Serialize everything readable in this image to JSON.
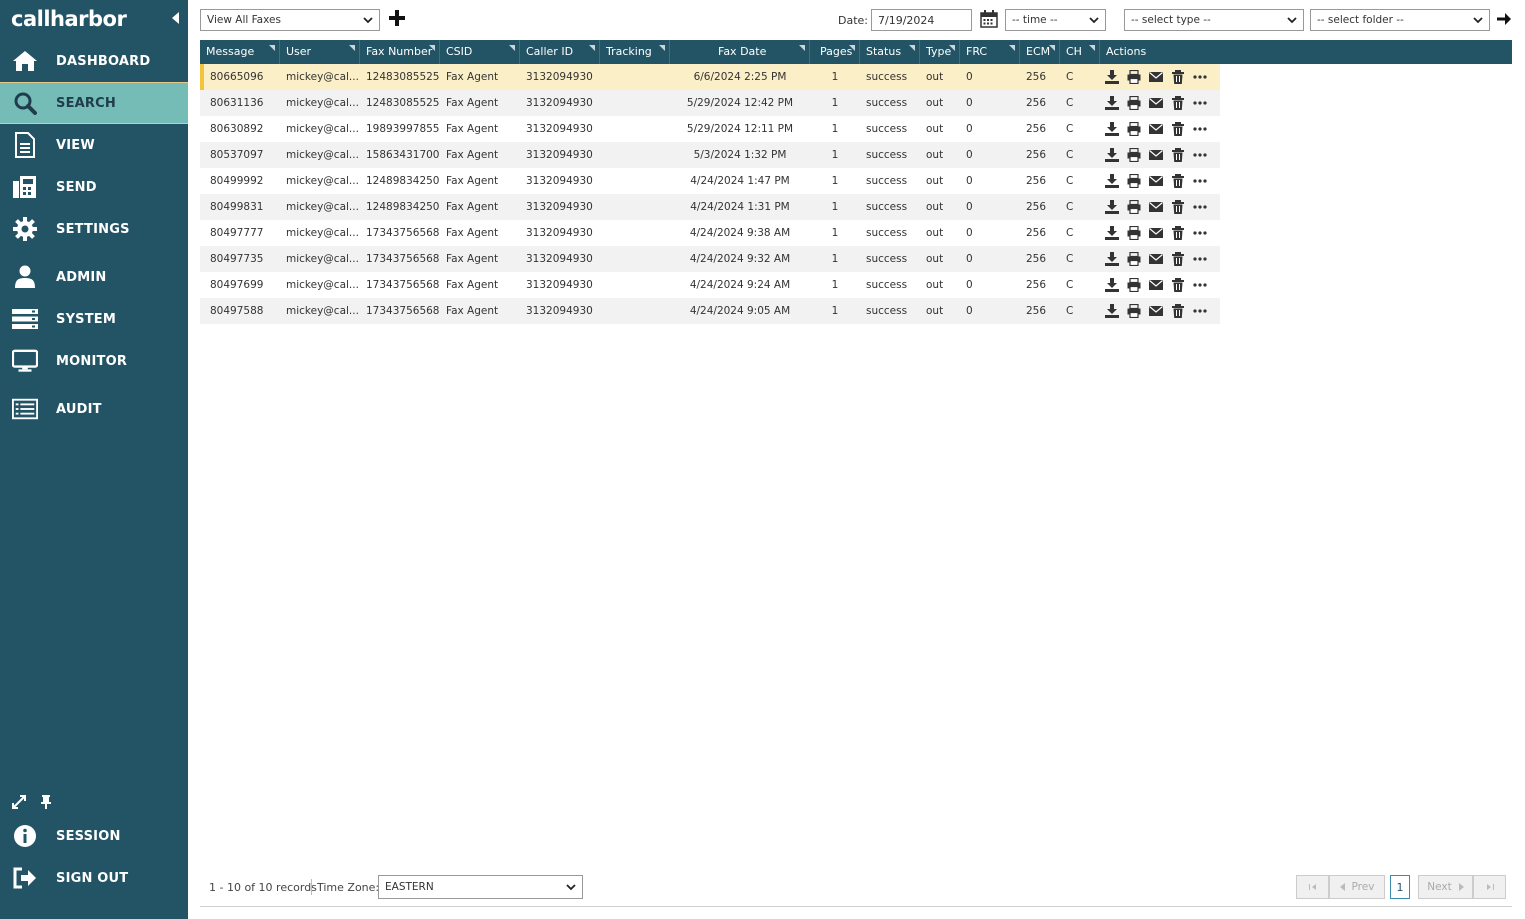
{
  "app": {
    "logo": "callharbor"
  },
  "sidebar": {
    "items": [
      {
        "label": "DASHBOARD",
        "icon": "home-icon"
      },
      {
        "label": "SEARCH",
        "icon": "search-icon",
        "active": true
      },
      {
        "label": "VIEW",
        "icon": "document-icon"
      },
      {
        "label": "SEND",
        "icon": "fax-icon"
      },
      {
        "label": "SETTINGS",
        "icon": "gear-icon"
      },
      {
        "label": "ADMIN",
        "icon": "user-icon"
      },
      {
        "label": "SYSTEM",
        "icon": "server-icon"
      },
      {
        "label": "MONITOR",
        "icon": "monitor-icon"
      },
      {
        "label": "AUDIT",
        "icon": "list-icon"
      }
    ],
    "bottom": [
      {
        "label": "SESSION",
        "icon": "info-icon"
      },
      {
        "label": "SIGN OUT",
        "icon": "sign-out-icon"
      }
    ]
  },
  "toolbar": {
    "view_select": "View All Faxes",
    "date_label": "Date:",
    "date_value": "7/19/2024",
    "time_select": "-- time --",
    "type_select": "-- select type --",
    "folder_select": "-- select folder --"
  },
  "grid": {
    "columns": [
      "Message",
      "User",
      "Fax Number",
      "CSID",
      "Caller ID",
      "Tracking",
      "Fax Date",
      "Pages",
      "Status",
      "Type",
      "FRC",
      "ECM",
      "CH",
      "Actions"
    ],
    "rows": [
      [
        "80665096",
        "mickey@cal...",
        "12483085525",
        "Fax Agent",
        "3132094930",
        "",
        "6/6/2024 2:25 PM",
        "1",
        "success",
        "out",
        "0",
        "256",
        "C"
      ],
      [
        "80631136",
        "mickey@cal...",
        "12483085525",
        "Fax Agent",
        "3132094930",
        "",
        "5/29/2024 12:42 PM",
        "1",
        "success",
        "out",
        "0",
        "256",
        "C"
      ],
      [
        "80630892",
        "mickey@cal...",
        "19893997855",
        "Fax Agent",
        "3132094930",
        "",
        "5/29/2024 12:11 PM",
        "1",
        "success",
        "out",
        "0",
        "256",
        "C"
      ],
      [
        "80537097",
        "mickey@cal...",
        "15863431700",
        "Fax Agent",
        "3132094930",
        "",
        "5/3/2024 1:32 PM",
        "1",
        "success",
        "out",
        "0",
        "256",
        "C"
      ],
      [
        "80499992",
        "mickey@cal...",
        "12489834250",
        "Fax Agent",
        "3132094930",
        "",
        "4/24/2024 1:47 PM",
        "1",
        "success",
        "out",
        "0",
        "256",
        "C"
      ],
      [
        "80499831",
        "mickey@cal...",
        "12489834250",
        "Fax Agent",
        "3132094930",
        "",
        "4/24/2024 1:31 PM",
        "1",
        "success",
        "out",
        "0",
        "256",
        "C"
      ],
      [
        "80497777",
        "mickey@cal...",
        "17343756568",
        "Fax Agent",
        "3132094930",
        "",
        "4/24/2024 9:38 AM",
        "1",
        "success",
        "out",
        "0",
        "256",
        "C"
      ],
      [
        "80497735",
        "mickey@cal...",
        "17343756568",
        "Fax Agent",
        "3132094930",
        "",
        "4/24/2024 9:32 AM",
        "1",
        "success",
        "out",
        "0",
        "256",
        "C"
      ],
      [
        "80497699",
        "mickey@cal...",
        "17343756568",
        "Fax Agent",
        "3132094930",
        "",
        "4/24/2024 9:24 AM",
        "1",
        "success",
        "out",
        "0",
        "256",
        "C"
      ],
      [
        "80497588",
        "mickey@cal...",
        "17343756568",
        "Fax Agent",
        "3132094930",
        "",
        "4/24/2024 9:05 AM",
        "1",
        "success",
        "out",
        "0",
        "256",
        "C"
      ]
    ],
    "selected_row": 0
  },
  "footer": {
    "records": "1 - 10 of 10 records",
    "tz_label": "Time Zone:",
    "tz_value": "EASTERN",
    "prev": "Prev",
    "next": "Next",
    "page": "1"
  },
  "colors": {
    "sidebar_bg": "#235466",
    "active_bg": "#75bcb6",
    "header_bg": "#235466",
    "selected_row": "#fbefc7"
  }
}
